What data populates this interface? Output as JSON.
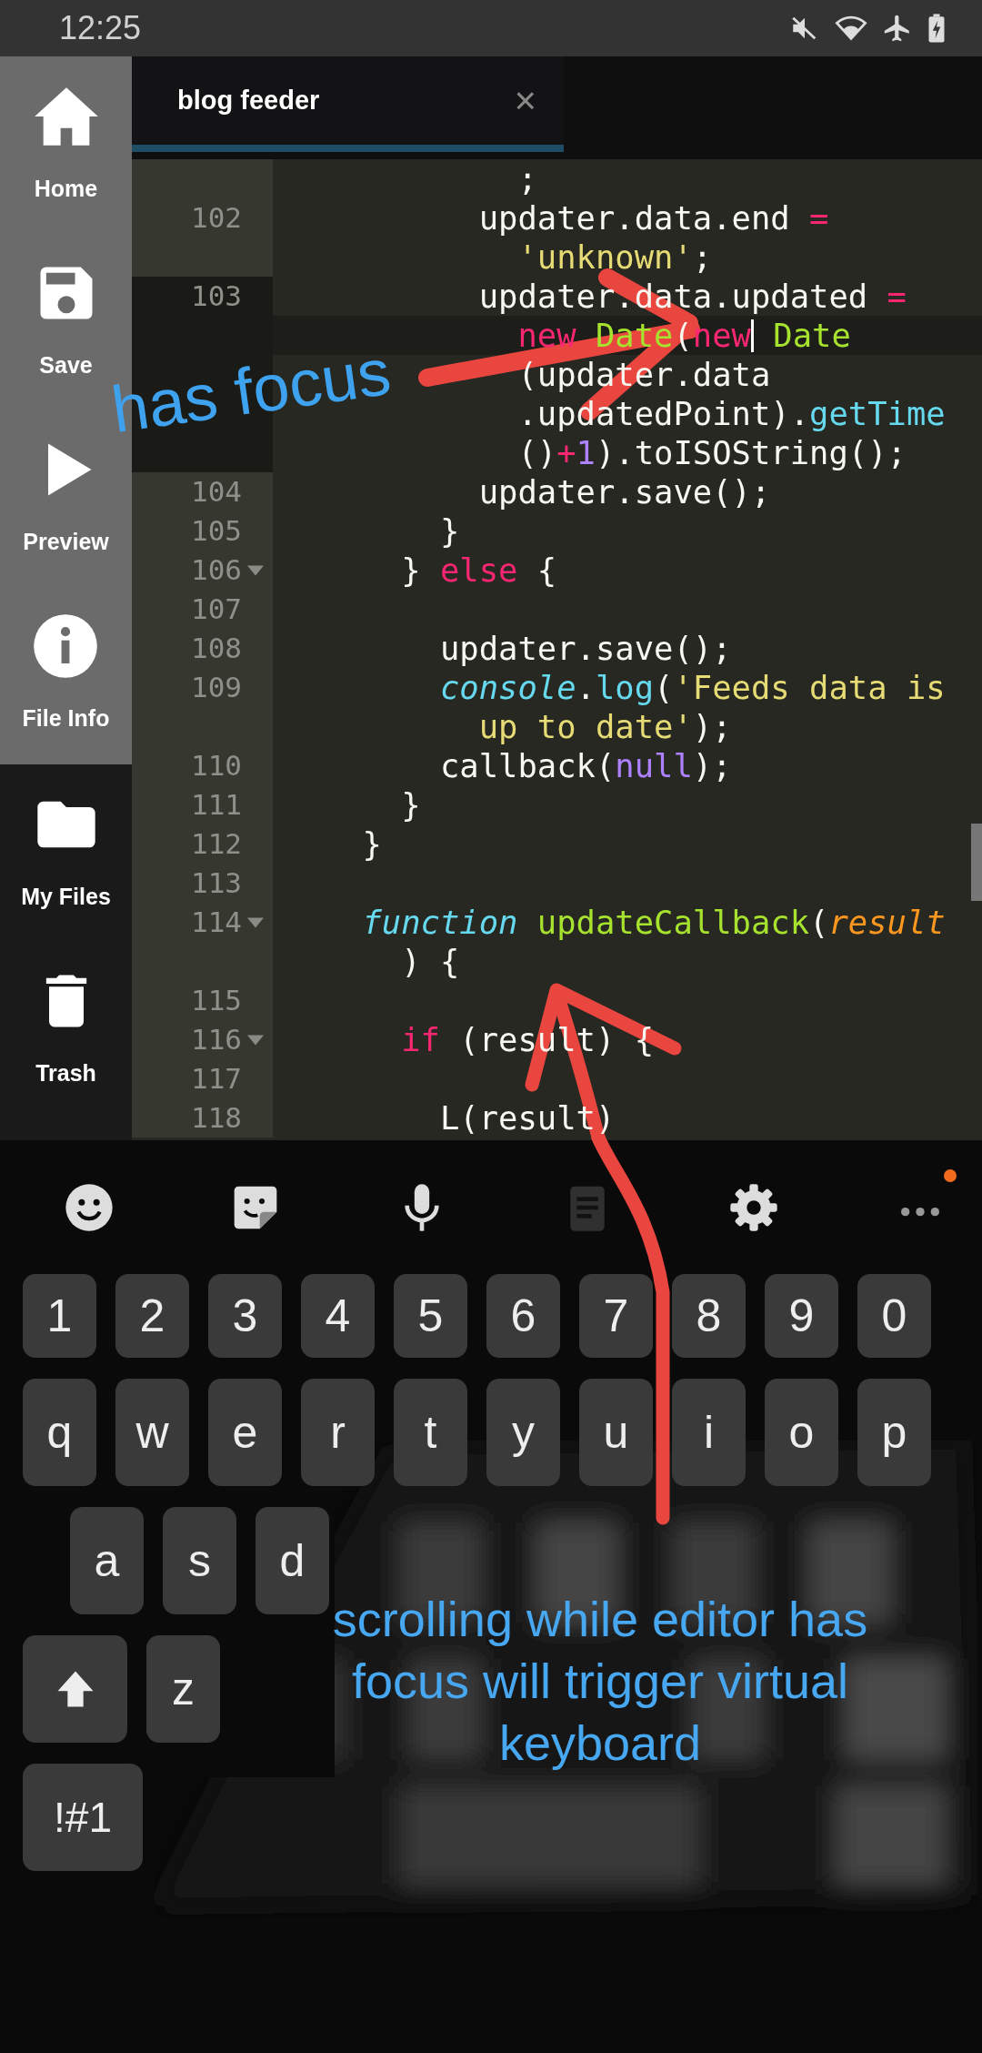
{
  "status_bar": {
    "time": "12:25"
  },
  "sidebar": {
    "file_actions": [
      {
        "label": "Home",
        "kind": "home"
      },
      {
        "label": "Save",
        "kind": "save"
      },
      {
        "label": "Preview",
        "kind": "play"
      },
      {
        "label": "File Info",
        "kind": "info"
      }
    ],
    "navigation": [
      {
        "label": "My Files",
        "kind": "folder"
      },
      {
        "label": "Trash",
        "kind": "trash"
      }
    ]
  },
  "tabs": [
    {
      "label": "blog feeder",
      "close": "×",
      "selected": true
    }
  ],
  "editor": {
    "rows": [
      {
        "number": "",
        "active": false,
        "fold": false,
        "tokens": [
          {
            "text": "            ;",
            "kind": "plain"
          }
        ]
      },
      {
        "number": "102",
        "active": false,
        "fold": false,
        "tokens": [
          {
            "text": "          updater.data.end ",
            "kind": "plain"
          },
          {
            "text": "=",
            "kind": "keyword"
          }
        ]
      },
      {
        "number": "",
        "active": false,
        "fold": false,
        "tokens": [
          {
            "text": "            'unknown'",
            "kind": "string"
          },
          {
            "text": ";",
            "kind": "plain"
          }
        ]
      },
      {
        "number": "103",
        "active": true,
        "fold": false,
        "tokens": [
          {
            "text": "          updater.data.updated ",
            "kind": "plain"
          },
          {
            "text": "=",
            "kind": "keyword"
          }
        ]
      },
      {
        "number": "",
        "active": true,
        "fold": false,
        "tokens": [
          {
            "text": "            new",
            "kind": "keyword"
          },
          {
            "text": " Date",
            "kind": "function"
          },
          {
            "text": "(",
            "kind": "plain"
          },
          {
            "text": "new",
            "kind": "keyword"
          },
          {
            "kind": "cursor"
          },
          {
            "text": " Date",
            "kind": "function"
          }
        ]
      },
      {
        "number": "",
        "active": true,
        "fold": false,
        "tokens": [
          {
            "text": "            (updater.data",
            "kind": "plain"
          }
        ]
      },
      {
        "number": "",
        "active": true,
        "fold": false,
        "tokens": [
          {
            "text": "            .updatedPoint).",
            "kind": "plain"
          },
          {
            "text": "getTime",
            "kind": "method"
          }
        ]
      },
      {
        "number": "",
        "active": true,
        "fold": false,
        "tokens": [
          {
            "text": "            ()",
            "kind": "plain"
          },
          {
            "text": "+",
            "kind": "keyword"
          },
          {
            "text": "1",
            "kind": "constant"
          },
          {
            "text": ").toISOString();",
            "kind": "plain"
          }
        ]
      },
      {
        "number": "104",
        "active": false,
        "fold": false,
        "tokens": [
          {
            "text": "          updater.save();",
            "kind": "plain"
          }
        ]
      },
      {
        "number": "105",
        "active": false,
        "fold": false,
        "tokens": [
          {
            "text": "        }",
            "kind": "plain"
          }
        ]
      },
      {
        "number": "106",
        "active": false,
        "fold": true,
        "tokens": [
          {
            "text": "      } ",
            "kind": "plain"
          },
          {
            "text": "else",
            "kind": "keyword"
          },
          {
            "text": " {",
            "kind": "plain"
          }
        ]
      },
      {
        "number": "107",
        "active": false,
        "fold": false,
        "tokens": []
      },
      {
        "number": "108",
        "active": false,
        "fold": false,
        "tokens": [
          {
            "text": "        updater.save();",
            "kind": "plain"
          }
        ]
      },
      {
        "number": "109",
        "active": false,
        "fold": false,
        "tokens": [
          {
            "text": "        console",
            "kind": "storage"
          },
          {
            "text": ".",
            "kind": "plain"
          },
          {
            "text": "log",
            "kind": "method"
          },
          {
            "text": "(",
            "kind": "plain"
          },
          {
            "text": "'Feeds data is",
            "kind": "string"
          }
        ]
      },
      {
        "number": "",
        "active": false,
        "fold": false,
        "tokens": [
          {
            "text": "          up to date'",
            "kind": "string"
          },
          {
            "text": ");",
            "kind": "plain"
          }
        ]
      },
      {
        "number": "110",
        "active": false,
        "fold": false,
        "tokens": [
          {
            "text": "        callback(",
            "kind": "plain"
          },
          {
            "text": "null",
            "kind": "constant"
          },
          {
            "text": ");",
            "kind": "plain"
          }
        ]
      },
      {
        "number": "111",
        "active": false,
        "fold": false,
        "tokens": [
          {
            "text": "      }",
            "kind": "plain"
          }
        ]
      },
      {
        "number": "112",
        "active": false,
        "fold": false,
        "tokens": [
          {
            "text": "    }",
            "kind": "plain"
          }
        ]
      },
      {
        "number": "113",
        "active": false,
        "fold": false,
        "tokens": []
      },
      {
        "number": "114",
        "active": false,
        "fold": true,
        "tokens": [
          {
            "text": "    function",
            "kind": "storage"
          },
          {
            "text": " updateCallback",
            "kind": "function"
          },
          {
            "text": "(",
            "kind": "plain"
          },
          {
            "text": "result",
            "kind": "param"
          }
        ]
      },
      {
        "number": "",
        "active": false,
        "fold": false,
        "tokens": [
          {
            "text": "      ) {",
            "kind": "plain"
          }
        ]
      },
      {
        "number": "115",
        "active": false,
        "fold": false,
        "tokens": []
      },
      {
        "number": "116",
        "active": false,
        "fold": true,
        "tokens": [
          {
            "text": "      if",
            "kind": "keyword"
          },
          {
            "text": " (result) {",
            "kind": "plain"
          }
        ]
      },
      {
        "number": "117",
        "active": false,
        "fold": false,
        "tokens": []
      },
      {
        "number": "118",
        "active": false,
        "fold": false,
        "tokens": [
          {
            "text": "        L(result)",
            "kind": "plain"
          }
        ]
      }
    ]
  },
  "keyboard": {
    "toolbar": [
      {
        "kind": "emoji",
        "disabled": false,
        "notification": false
      },
      {
        "kind": "sticker",
        "disabled": false,
        "notification": false
      },
      {
        "kind": "mic",
        "disabled": false,
        "notification": false
      },
      {
        "kind": "clipboard",
        "disabled": true,
        "notification": false
      },
      {
        "kind": "settings",
        "disabled": false,
        "notification": false
      },
      {
        "kind": "more",
        "disabled": false,
        "notification": true
      }
    ],
    "rows": [
      [
        {
          "kind": "char",
          "label": "1"
        },
        {
          "kind": "char",
          "label": "2"
        },
        {
          "kind": "char",
          "label": "3"
        },
        {
          "kind": "char",
          "label": "4"
        },
        {
          "kind": "char",
          "label": "5"
        },
        {
          "kind": "char",
          "label": "6"
        },
        {
          "kind": "char",
          "label": "7"
        },
        {
          "kind": "char",
          "label": "8"
        },
        {
          "kind": "char",
          "label": "9"
        },
        {
          "kind": "char",
          "label": "0"
        }
      ],
      [
        {
          "kind": "char",
          "label": "q"
        },
        {
          "kind": "char",
          "label": "w"
        },
        {
          "kind": "char",
          "label": "e"
        },
        {
          "kind": "char",
          "label": "r"
        },
        {
          "kind": "char",
          "label": "t"
        },
        {
          "kind": "char",
          "label": "y"
        },
        {
          "kind": "char",
          "label": "u"
        },
        {
          "kind": "char",
          "label": "i"
        },
        {
          "kind": "char",
          "label": "o"
        },
        {
          "kind": "char",
          "label": "p"
        }
      ],
      [
        {
          "kind": "char",
          "label": "a"
        },
        {
          "kind": "char",
          "label": "s"
        },
        {
          "kind": "char",
          "label": "d"
        }
      ],
      [
        {
          "kind": "shift"
        },
        {
          "kind": "char",
          "label": "z"
        }
      ],
      [
        {
          "kind": "symbols",
          "label": "!#1"
        }
      ]
    ]
  },
  "annotations": [
    {
      "kind": "tilted",
      "text": "has focus"
    },
    {
      "kind": "centered",
      "text": "scrolling while editor has focus will trigger virtual keyboard"
    }
  ]
}
